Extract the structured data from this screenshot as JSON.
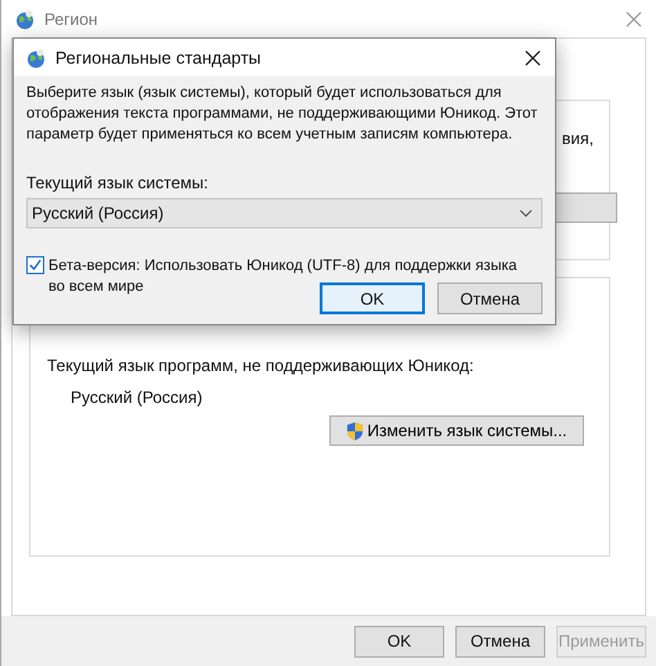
{
  "window": {
    "title": "Регион"
  },
  "region_group": {
    "fragment": "вия,"
  },
  "unicode_group": {
    "label": "Текущий язык программ, не поддерживающих Юникод:",
    "value": "Русский (Россия)",
    "button": "Изменить язык системы..."
  },
  "buttons": [
    {
      "label": "OK",
      "disabled": false
    },
    {
      "label": "Отмена",
      "disabled": false
    },
    {
      "label": "Применить",
      "disabled": true
    }
  ],
  "dialog": {
    "title": "Региональные стандарты",
    "description": "Выберите язык (язык системы), который будет использоваться для отображения текста программами, не поддерживающими Юникод. Этот параметр будет применяться ко всем учетным записям компьютера.",
    "combo_label": "Текущий язык системы:",
    "combo_value": "Русский (Россия)",
    "checkbox": {
      "label": "Бета-версия: Использовать Юникод (UTF-8) для поддержки языка во всем мире",
      "checked": true
    },
    "buttons": [
      {
        "label": "OK",
        "default": true
      },
      {
        "label": "Отмена",
        "default": false
      }
    ]
  }
}
